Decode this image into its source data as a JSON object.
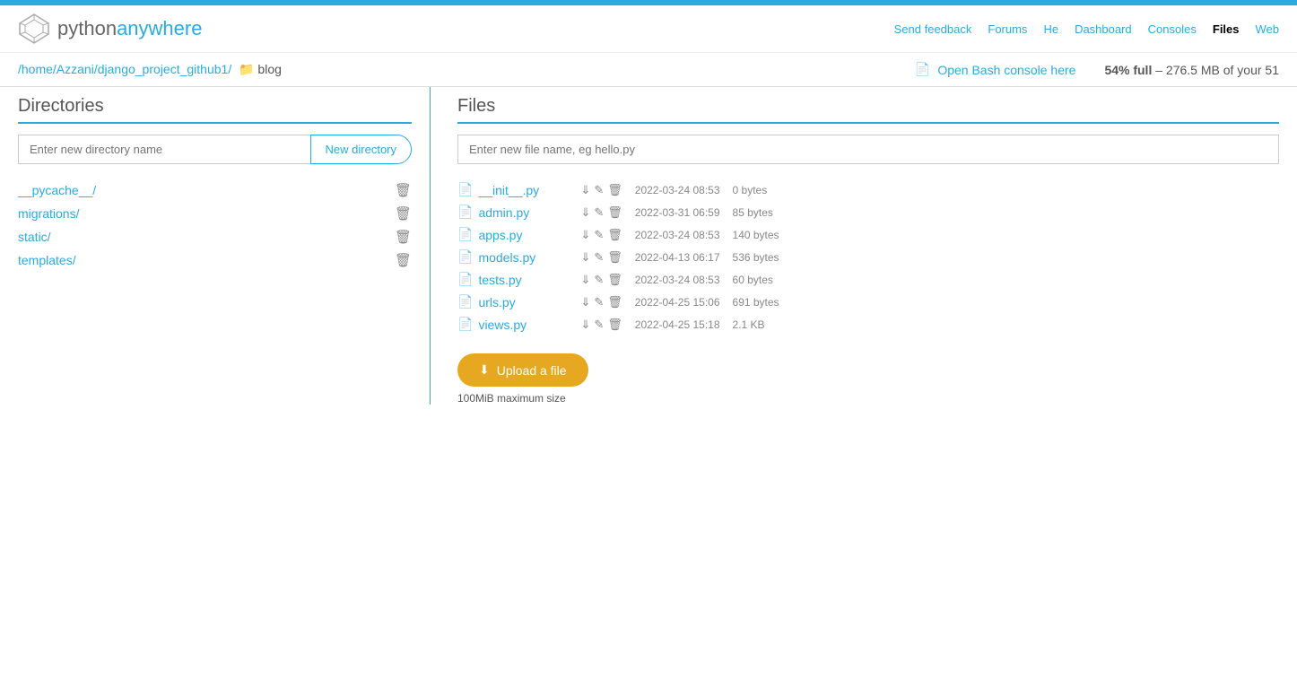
{
  "topbar": {
    "color": "#29abe2"
  },
  "nav": {
    "logo_python": "python",
    "logo_anywhere": "anywhere",
    "links": [
      {
        "label": "Send feedback",
        "active": false
      },
      {
        "label": "Forums",
        "active": false
      },
      {
        "label": "Help",
        "active": false
      },
      {
        "label": "Dashboard",
        "active": false
      },
      {
        "label": "Consoles",
        "active": false
      },
      {
        "label": "Files",
        "active": true
      },
      {
        "label": "Web",
        "active": false
      }
    ]
  },
  "breadcrumb": {
    "parts": [
      {
        "label": "/home",
        "href": "#"
      },
      {
        "label": "/Azzani",
        "href": "#"
      },
      {
        "label": "/django_project_github1",
        "href": "#"
      },
      {
        "label": "/",
        "href": "#"
      }
    ],
    "current": "blog"
  },
  "bash": {
    "label": "Open Bash console here"
  },
  "disk": {
    "percent": "54% full",
    "separator": "–",
    "usage": "276.5 MB of your 51"
  },
  "directories": {
    "title": "Directories",
    "new_dir_placeholder": "Enter new directory name",
    "new_dir_button": "New directory",
    "items": [
      {
        "name": "__pycache__/"
      },
      {
        "name": "migrations/"
      },
      {
        "name": "static/"
      },
      {
        "name": "templates/"
      }
    ]
  },
  "files": {
    "title": "Files",
    "new_file_placeholder": "Enter new file name, eg hello.py",
    "items": [
      {
        "name": "__init__.py",
        "date": "2022-03-24 08:53",
        "size": "0 bytes"
      },
      {
        "name": "admin.py",
        "date": "2022-03-31 06:59",
        "size": "85 bytes"
      },
      {
        "name": "apps.py",
        "date": "2022-03-24 08:53",
        "size": "140 bytes"
      },
      {
        "name": "models.py",
        "date": "2022-04-13 06:17",
        "size": "536 bytes"
      },
      {
        "name": "tests.py",
        "date": "2022-03-24 08:53",
        "size": "60 bytes"
      },
      {
        "name": "urls.py",
        "date": "2022-04-25 15:06",
        "size": "691 bytes"
      },
      {
        "name": "views.py",
        "date": "2022-04-25 15:18",
        "size": "2.1 KB"
      }
    ],
    "upload_button": "Upload a file",
    "upload_max": "100MiB maximum size"
  }
}
